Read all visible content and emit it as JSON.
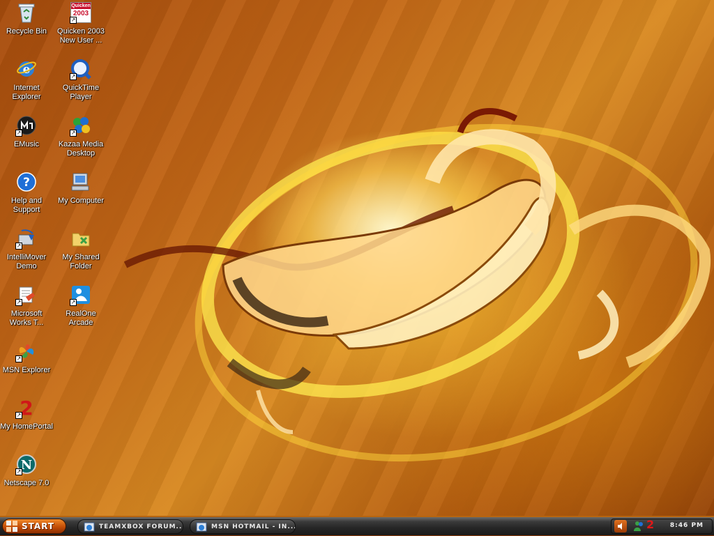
{
  "desktop": {
    "icons": [
      {
        "label": "Recycle Bin",
        "icon": "recycle-bin-icon"
      },
      {
        "label": "Quicken 2003\nNew User ...",
        "icon": "quicken-icon"
      },
      {
        "label": "Internet\nExplorer",
        "icon": "internet-explorer-icon"
      },
      {
        "label": "QuickTime\nPlayer",
        "icon": "quicktime-icon"
      },
      {
        "label": "EMusic",
        "icon": "emusic-icon"
      },
      {
        "label": "Kazaa Media\nDesktop",
        "icon": "kazaa-icon"
      },
      {
        "label": "Help and\nSupport",
        "icon": "help-icon"
      },
      {
        "label": "My Computer",
        "icon": "my-computer-icon"
      },
      {
        "label": "IntelliMover\nDemo",
        "icon": "intellimover-icon"
      },
      {
        "label": "My Shared\nFolder",
        "icon": "shared-folder-icon"
      },
      {
        "label": "Microsoft\nWorks T...",
        "icon": "works-icon"
      },
      {
        "label": "RealOne\nArcade",
        "icon": "realone-icon"
      },
      {
        "label": "MSN Explorer",
        "icon": "msn-icon"
      },
      {
        "label": "My HomePortal",
        "icon": "homeportal-icon"
      },
      {
        "label": "Netscape 7.0",
        "icon": "netscape-icon"
      }
    ],
    "quicken_badge_top": "Quicken",
    "quicken_badge_year": "2003"
  },
  "taskbar": {
    "start_label": "START",
    "tasks": [
      {
        "label": "TEAMXBOX FORUM...",
        "icon": "browser-window-icon"
      },
      {
        "label": "MSN HOTMAIL - IN...",
        "icon": "browser-window-icon"
      }
    ],
    "clock": "8:46 PM",
    "tray_icons": [
      "volume-icon",
      "messenger-icon",
      "homeportal-tray-icon"
    ],
    "tray_badge": "2"
  },
  "colors": {
    "accent": "#c34d06",
    "taskbar": "#262626",
    "desktop_text": "#ffffff"
  }
}
